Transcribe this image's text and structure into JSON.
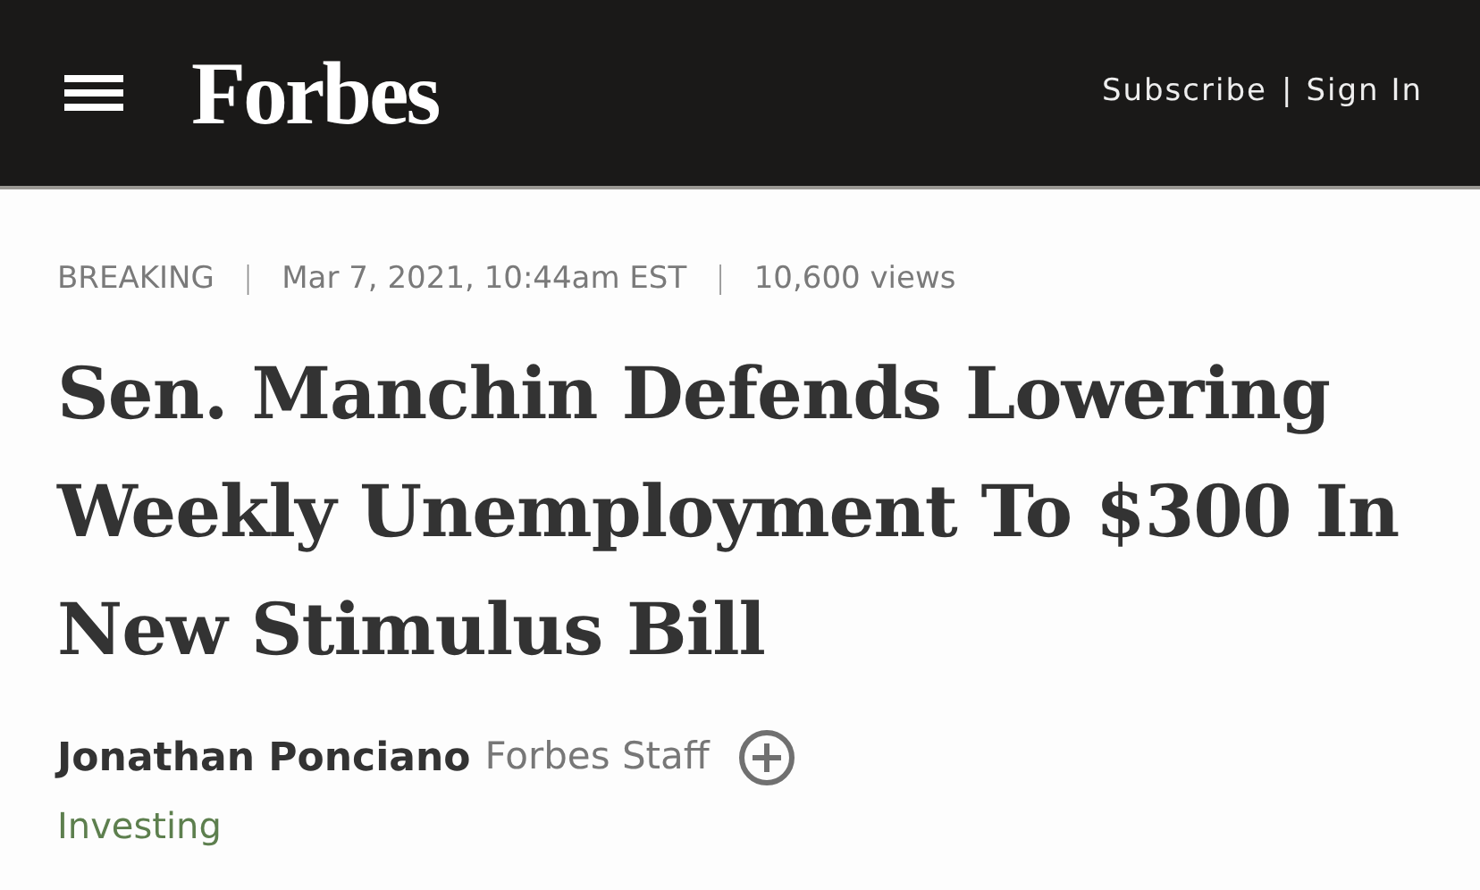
{
  "header": {
    "logo": "Forbes",
    "links": [
      {
        "kind": "link",
        "text": "Subscribe"
      },
      {
        "kind": "separator",
        "text": "|"
      },
      {
        "kind": "link",
        "text": "Sign In"
      }
    ]
  },
  "meta": [
    {
      "kind": "text",
      "text": "BREAKING"
    },
    {
      "kind": "separator",
      "text": "|"
    },
    {
      "kind": "text",
      "text": "Mar 7, 2021, 10:44am EST"
    },
    {
      "kind": "separator",
      "text": "|"
    },
    {
      "kind": "text",
      "text": "10,600 views"
    }
  ],
  "headline": "Sen. Manchin Defends Lowering Weekly Unemployment To $300 In New Stimulus Bill",
  "author": {
    "name": "Jonathan Ponciano",
    "role": "Forbes Staff"
  },
  "section": "Investing"
}
